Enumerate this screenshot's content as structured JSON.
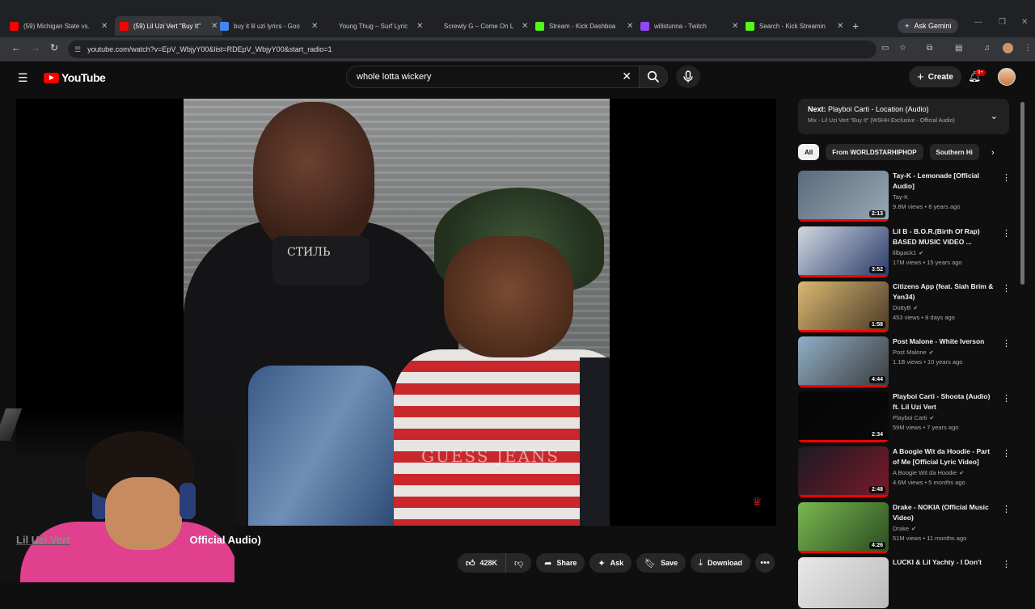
{
  "browser": {
    "tabs": [
      {
        "title": "(59) Michigan State vs.",
        "favicon_color": "#ff0000"
      },
      {
        "title": "(59) Lil Uzi Vert \"Buy It\"",
        "favicon_color": "#ff0000"
      },
      {
        "title": "buy it lil uzi lyrics - Goo",
        "favicon_color": "#4285f4"
      },
      {
        "title": "Young Thug – Surf Lyric",
        "favicon_color": "#222222"
      },
      {
        "title": "Screwly G – Come On L",
        "favicon_color": "#222222"
      },
      {
        "title": "Stream - Kick Dashboa",
        "favicon_color": "#53fc18"
      },
      {
        "title": "willstunna - Twitch",
        "favicon_color": "#9146ff"
      },
      {
        "title": "Search - Kick Streamin",
        "favicon_color": "#53fc18"
      }
    ],
    "gemini_label": "Ask Gemini",
    "url": "youtube.com/watch?v=EpV_WbjyY00&list=RDEpV_WbjyY00&start_radio=1"
  },
  "youtube": {
    "logo_text": "YouTube",
    "search_value": "whole lotta wickery",
    "create_label": "Create",
    "notification_count": "9+"
  },
  "video": {
    "overlay_text": "СТИЛЬ",
    "shirt_text": "GUESS JEANS",
    "title_left": "Lil Uzi Vert",
    "title_right": "Official Audio)",
    "like_count": "428K",
    "share_label": "Share",
    "ask_label": "Ask",
    "save_label": "Save",
    "download_label": "Download"
  },
  "sidebar": {
    "next_prefix": "Next:",
    "next_title": "Playboi Carti - Location (Audio)",
    "mix_title": "Mix - Lil Uzi Vert \"Buy It\" (WSHH Exclusive - Official Audio)",
    "chips": [
      "All",
      "From WORLDSTARHIPHOP",
      "Southern Hi"
    ],
    "recommendations": [
      {
        "title": "Tay-K - Lemonade [Official Audio]",
        "channel": "Tay-K",
        "verified": false,
        "meta": "9.8M views • 8 years ago",
        "duration": "2:13",
        "progress": 1.0,
        "colors": [
          "#5a6a7a",
          "#9aa8b6"
        ]
      },
      {
        "title": "Lil B - B.O.R.(Birth Of Rap) BASED MUSIC VIDEO ...",
        "channel": "lilbpack1",
        "verified": true,
        "meta": "17M views • 15 years ago",
        "duration": "3:52",
        "progress": 1.0,
        "colors": [
          "#cfd8e0",
          "#2a3a6a"
        ]
      },
      {
        "title": "Citizens App (feat. Siah Brim & Yen34)",
        "channel": "DottyB",
        "verified": true,
        "meta": "453 views • 8 days ago",
        "duration": "1:58",
        "progress": 1.0,
        "colors": [
          "#d8b870",
          "#4a3a28"
        ]
      },
      {
        "title": "Post Malone - White Iverson",
        "channel": "Post Malone",
        "verified": true,
        "meta": "1.1B views • 10 years ago",
        "duration": "4:44",
        "progress": 1.0,
        "colors": [
          "#8fb0c8",
          "#3a3a3a"
        ]
      },
      {
        "title": "Playboi Carti - Shoota (Audio) ft. Lil Uzi Vert",
        "channel": "Playboi Carti",
        "verified": true,
        "meta": "59M views • 7 years ago",
        "duration": "2:34",
        "progress": 1.0,
        "colors": [
          "#050505",
          "#0a0a0a"
        ]
      },
      {
        "title": "A Boogie Wit da Hoodie - Part of Me [Official Lyric Video]",
        "channel": "A Boogie Wit da Hoodie",
        "verified": true,
        "meta": "4.6M views • 5 months ago",
        "duration": "2:48",
        "progress": 1.0,
        "colors": [
          "#1a1a22",
          "#7a1a2a"
        ]
      },
      {
        "title": "Drake - NOKIA (Official Music Video)",
        "channel": "Drake",
        "verified": true,
        "meta": "51M views • 11 months ago",
        "duration": "4:26",
        "progress": 1.0,
        "colors": [
          "#7ab850",
          "#2a4a20"
        ]
      },
      {
        "title": "LUCKI & Lil Yachty - I Don't",
        "channel": "",
        "verified": false,
        "meta": "",
        "duration": "",
        "progress": 0.0,
        "colors": [
          "#e8e8e8",
          "#bbbbbb"
        ]
      }
    ]
  }
}
